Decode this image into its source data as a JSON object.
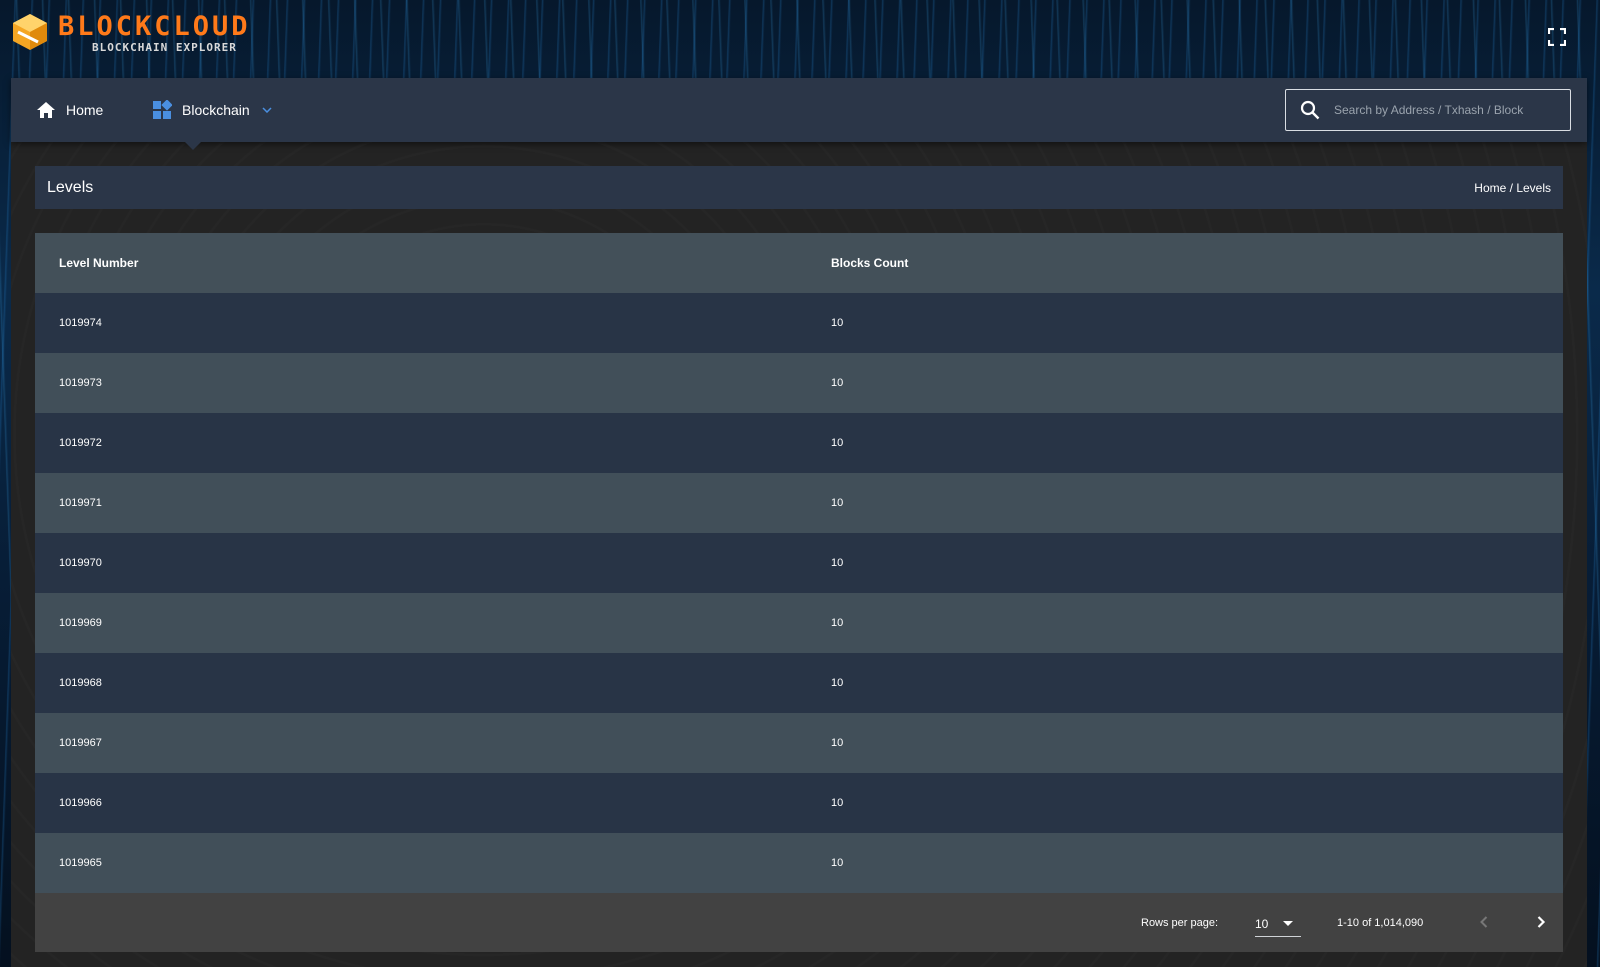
{
  "brand": {
    "title": "BLOCKCLOUD",
    "subtitle": "BLOCKCHAIN EXPLORER"
  },
  "nav": {
    "home_label": "Home",
    "blockchain_label": "Blockchain",
    "search_placeholder": "Search by Address / Txhash / Block"
  },
  "page": {
    "title": "Levels",
    "breadcrumb": {
      "home": "Home",
      "separator": " / ",
      "current": "Levels"
    }
  },
  "table": {
    "columns": [
      "Level Number",
      "Blocks Count"
    ],
    "rows": [
      [
        "1019974",
        "10"
      ],
      [
        "1019973",
        "10"
      ],
      [
        "1019972",
        "10"
      ],
      [
        "1019971",
        "10"
      ],
      [
        "1019970",
        "10"
      ],
      [
        "1019969",
        "10"
      ],
      [
        "1019968",
        "10"
      ],
      [
        "1019967",
        "10"
      ],
      [
        "1019966",
        "10"
      ],
      [
        "1019965",
        "10"
      ]
    ]
  },
  "pagination": {
    "rows_per_page_label": "Rows per page:",
    "rows_per_page": "10",
    "range": "1-10 of 1,014,090"
  },
  "colors": {
    "brand_orange": "#ff7a1a",
    "nav_bg": "#2b3648",
    "row_dark": "#283446",
    "row_light": "#414f59",
    "accent_blue": "#4a8fe0"
  },
  "icons": [
    "fullscreen-icon",
    "home-icon",
    "dashboard-icon",
    "chevron-down-icon",
    "search-icon",
    "chevron-left-icon",
    "chevron-right-icon"
  ]
}
